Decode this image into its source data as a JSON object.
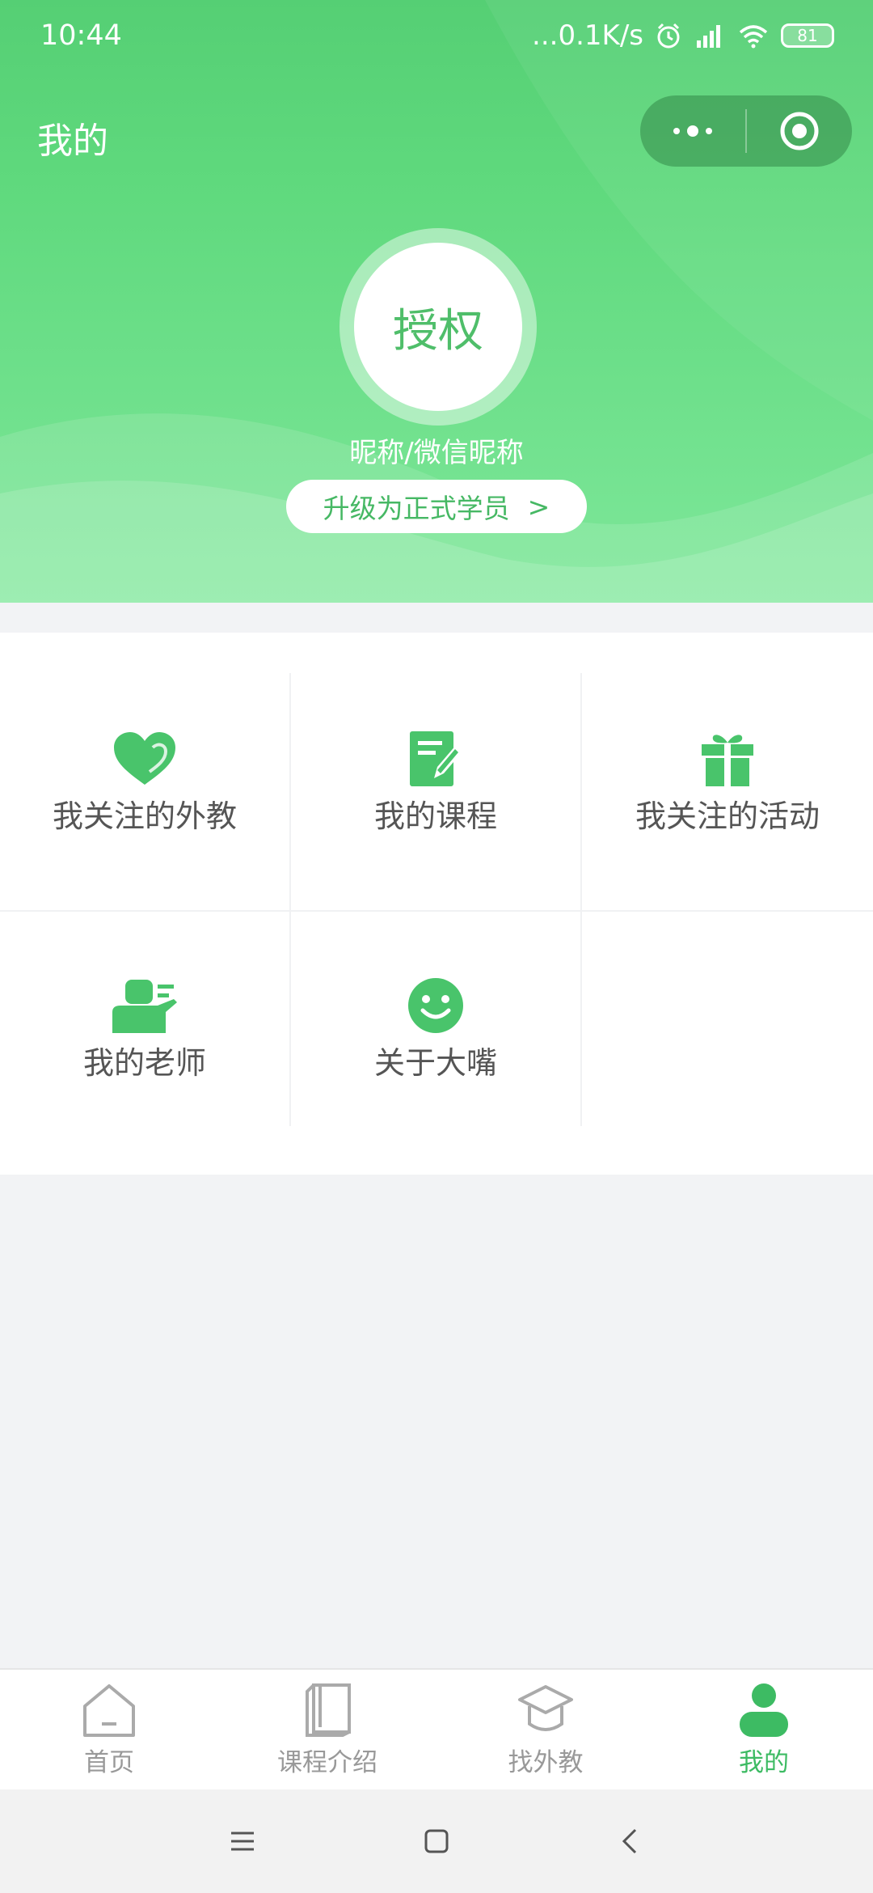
{
  "status_bar": {
    "time": "10:44",
    "network_speed": "...0.1K/s",
    "battery": "81"
  },
  "nav": {
    "title": "我的"
  },
  "profile": {
    "avatar_text": "授权",
    "nickname": "昵称/微信昵称",
    "upgrade_label": "升级为正式学员",
    "upgrade_arrow": ">"
  },
  "menu": {
    "items": [
      {
        "label": "我关注的外教",
        "icon": "heart-icon"
      },
      {
        "label": "我的课程",
        "icon": "notebook-edit-icon"
      },
      {
        "label": "我关注的活动",
        "icon": "gift-icon"
      },
      {
        "label": "我的老师",
        "icon": "teacher-board-icon"
      },
      {
        "label": "关于大嘴",
        "icon": "smile-icon"
      }
    ]
  },
  "tabbar": {
    "tabs": [
      {
        "label": "首页",
        "icon": "home-icon"
      },
      {
        "label": "课程介绍",
        "icon": "book-icon"
      },
      {
        "label": "找外教",
        "icon": "graduation-cap-icon"
      },
      {
        "label": "我的",
        "icon": "user-icon"
      }
    ],
    "active_index": 3
  },
  "colors": {
    "brand_green": "#3dbb63",
    "header_top": "#55cf74",
    "inactive_gray": "#999999"
  }
}
